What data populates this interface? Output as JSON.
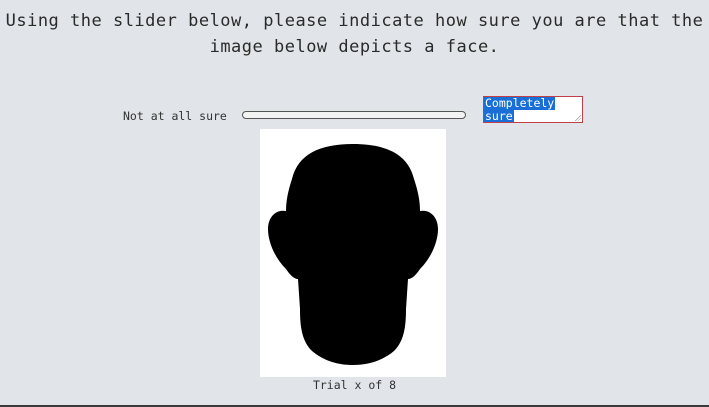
{
  "prompt": {
    "line1": "Using the slider below, please indicate how sure you are that the",
    "line2": "image below depicts a face."
  },
  "slider": {
    "left_label": "Not at all sure",
    "right_label_line1": "Completely",
    "right_label_line2": "sure"
  },
  "stimulus": {
    "image": "face-silhouette",
    "fill_color": "#000000",
    "background_color": "#ffffff"
  },
  "trial": {
    "counter": "Trial x of 8"
  }
}
